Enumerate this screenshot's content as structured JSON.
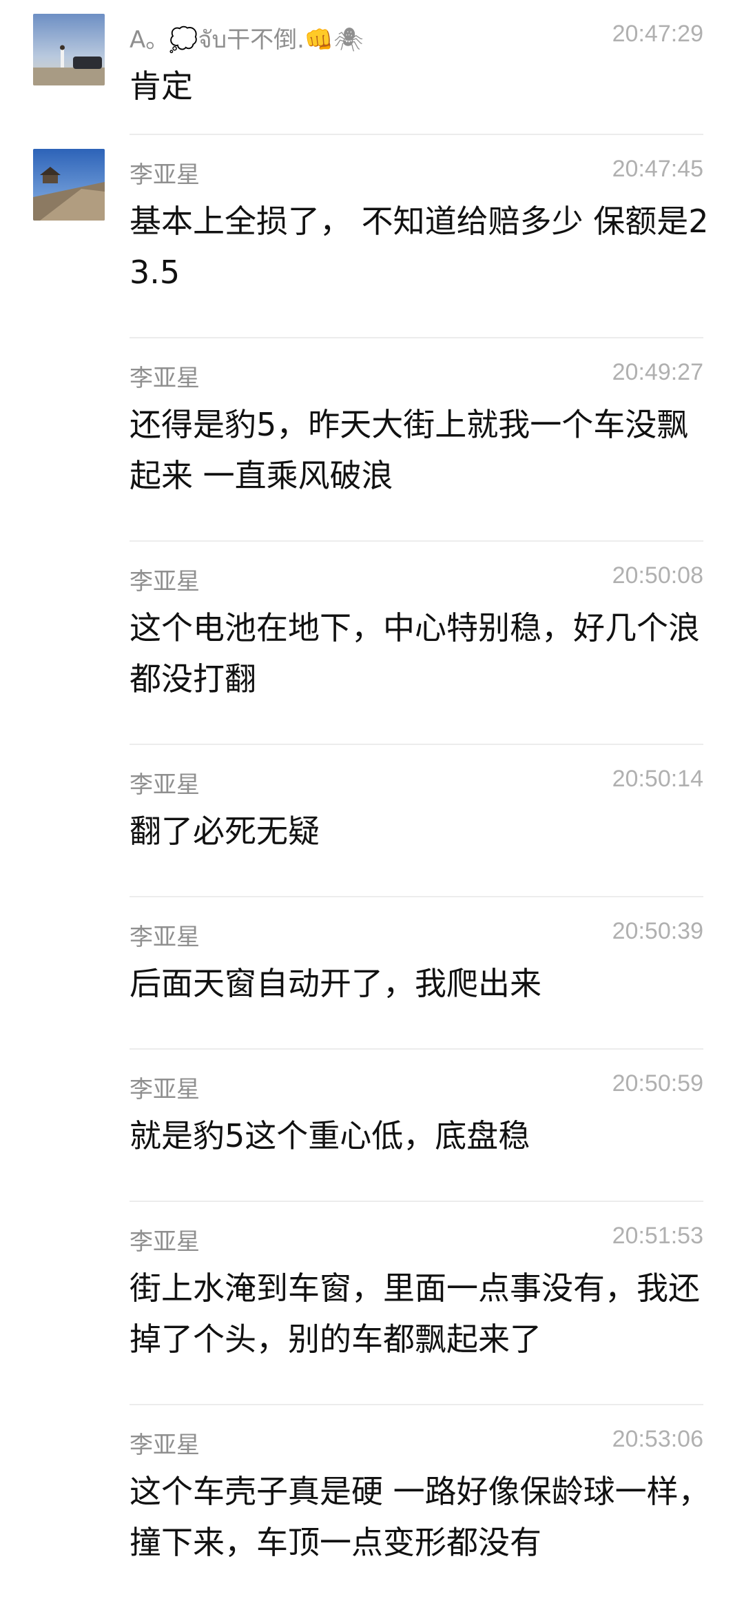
{
  "messages": [
    {
      "sender": "A。💭จับ干不倒.👊🕷",
      "time": "20:47:29",
      "text": "肯定"
    },
    {
      "sender": "李亚星",
      "time": "20:47:45",
      "text": "基本上全损了，  不知道给赔多少 保额是23.5"
    },
    {
      "sender": "李亚星",
      "time": "20:49:27",
      "text": "还得是豹5，昨天大街上就我一个车没飘起来  一直乘风破浪"
    },
    {
      "sender": "李亚星",
      "time": "20:50:08",
      "text": "这个电池在地下，中心特别稳，好几个浪都没打翻"
    },
    {
      "sender": "李亚星",
      "time": "20:50:14",
      "text": "翻了必死无疑"
    },
    {
      "sender": "李亚星",
      "time": "20:50:39",
      "text": "后面天窗自动开了，我爬出来"
    },
    {
      "sender": "李亚星",
      "time": "20:50:59",
      "text": "就是豹5这个重心低，底盘稳"
    },
    {
      "sender": "李亚星",
      "time": "20:51:53",
      "text": "街上水淹到车窗，里面一点事没有，我还掉了个头，别的车都飘起来了"
    },
    {
      "sender": "李亚星",
      "time": "20:53:06",
      "text": "这个车壳子真是硬 一路好像保龄球一样，撞下来，车顶一点变形都没有"
    }
  ]
}
